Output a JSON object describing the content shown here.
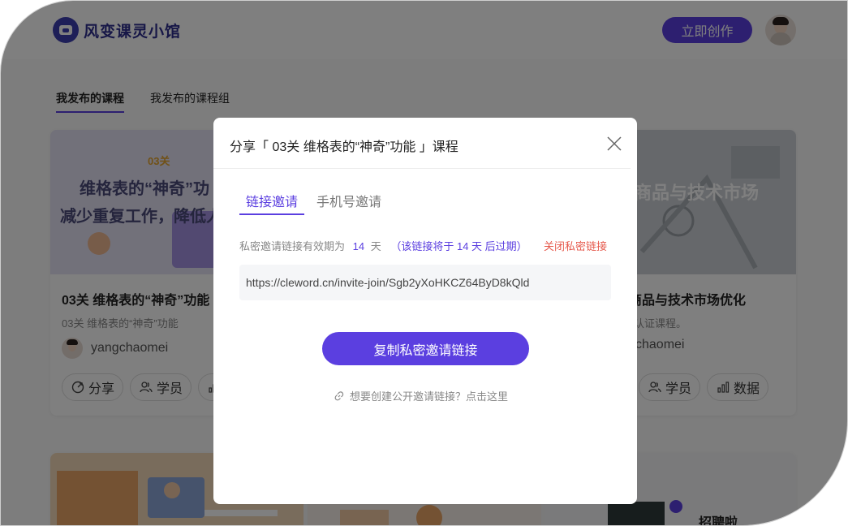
{
  "header": {
    "brand": "风变课灵小馆",
    "create_button": "立即创作"
  },
  "page_tabs": [
    {
      "label": "我发布的课程",
      "active": true
    },
    {
      "label": "我发布的课程组",
      "active": false
    }
  ],
  "cards": [
    {
      "image_tag": "03关",
      "image_line1": "维格表的“神奇”功",
      "image_line2": "减少重复工作，降低人",
      "title": "03关 维格表的“神奇”功能",
      "subtitle": "03关 维格表的“神奇”功能",
      "author": "yangchaomei",
      "actions": [
        "分享",
        "学员",
        "数"
      ]
    },
    {
      "image_text": "商品与技术市场",
      "title": "商品与技术市场优化",
      "subtitle": "认证课程。",
      "author": "chaomei",
      "actions": [
        "学员",
        "数据"
      ]
    }
  ],
  "bottom_card_text": "招聘啦",
  "modal": {
    "title": "分享「 03关 维格表的“神奇”功能 」课程",
    "tabs": [
      "链接邀请",
      "手机号邀请"
    ],
    "info_prefix": "私密邀请链接有效期为",
    "info_days": "14",
    "info_unit": "天",
    "info_note": "（该链接将于 14 天 后过期）",
    "close_link": "关闭私密链接",
    "invite_url": "https://cleword.cn/invite-join/Sgb2yXoHKCZ64ByD8kQld",
    "copy_button": "复制私密邀请链接",
    "public_link": "想要创建公开邀请链接？点击这里"
  },
  "colors": {
    "accent": "#5b3fe0",
    "danger": "#e65a4d",
    "brand": "#2e2f8f"
  }
}
